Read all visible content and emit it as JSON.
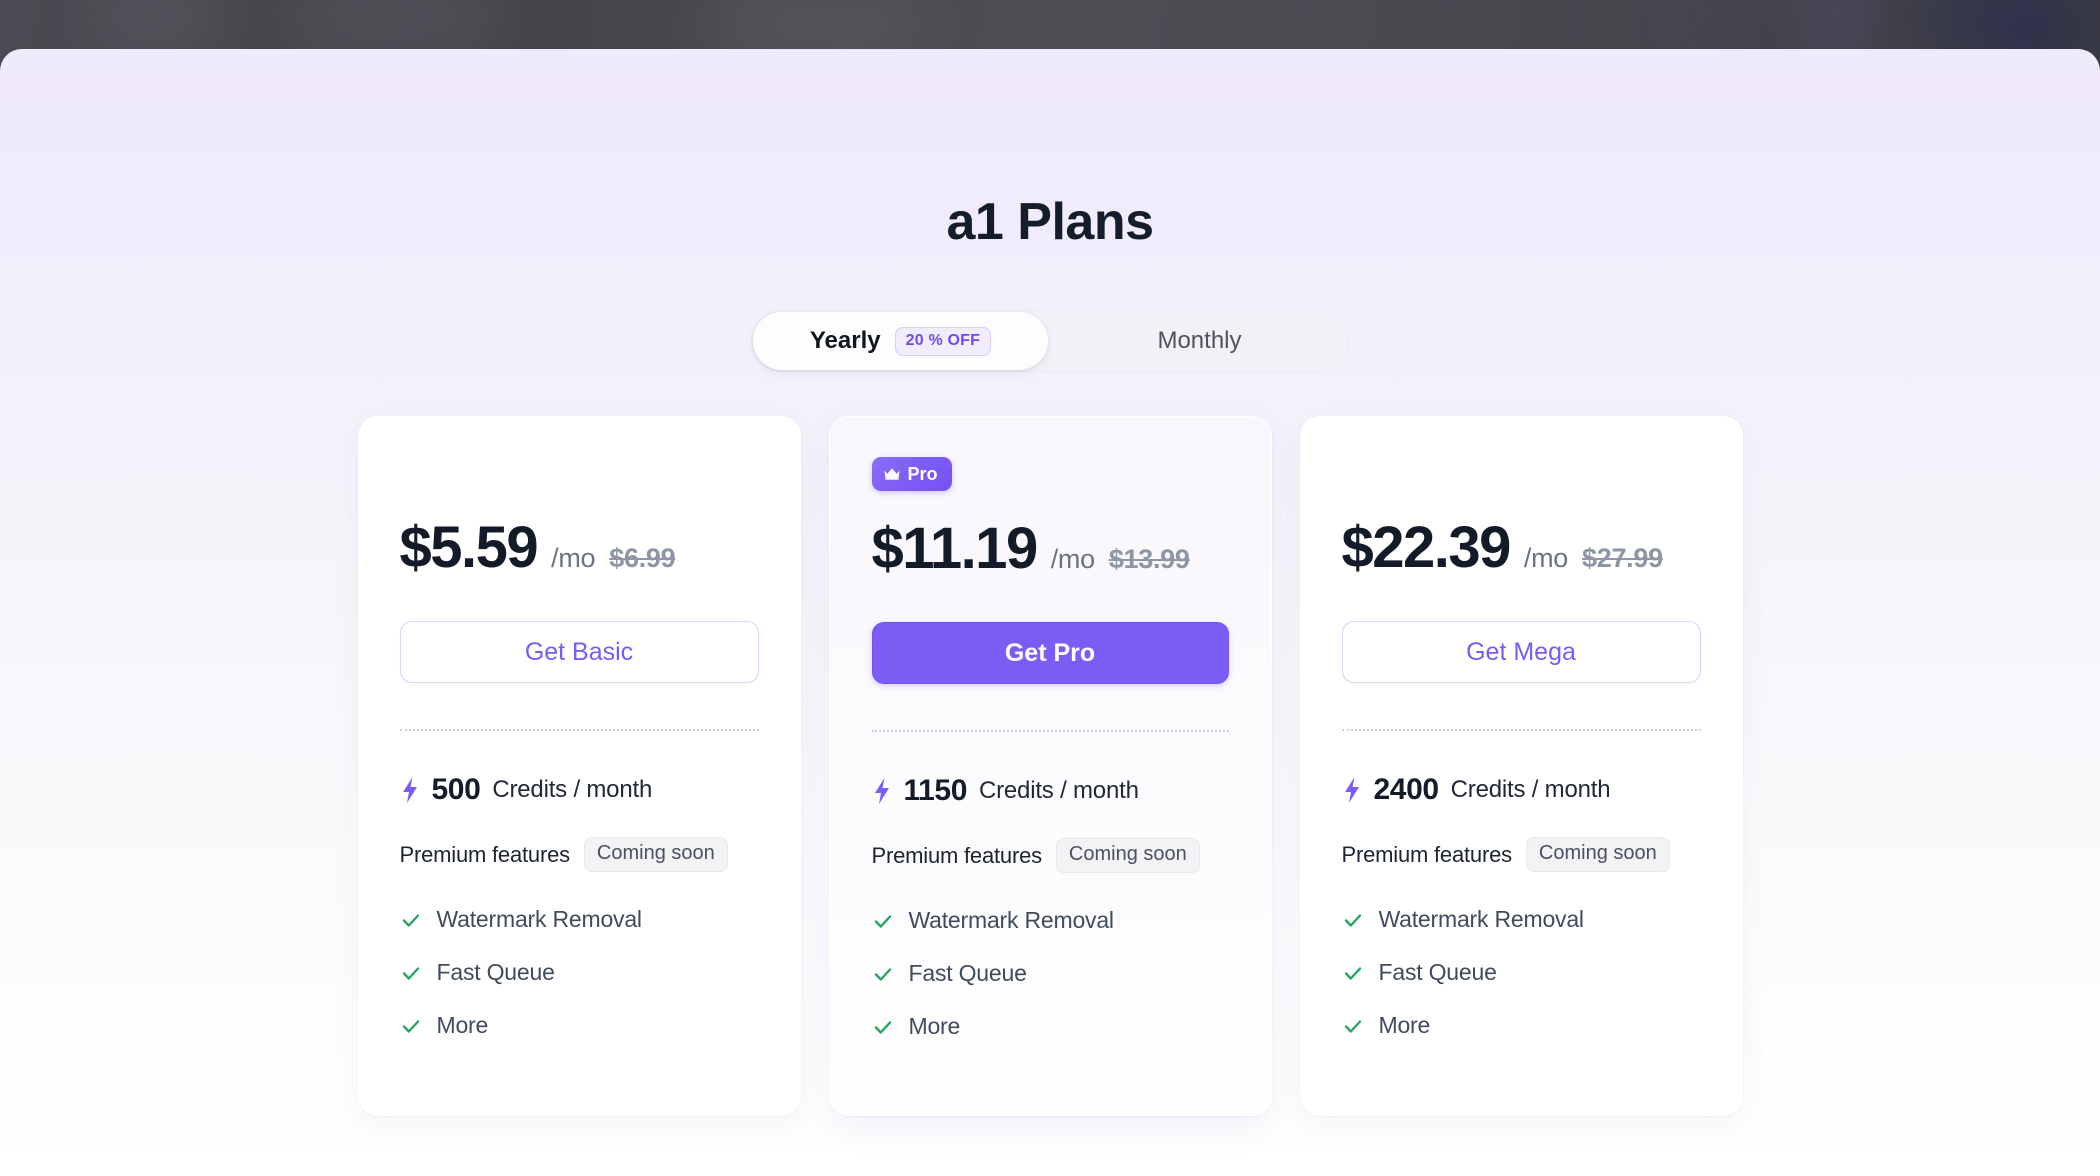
{
  "modal": {
    "title": "a1 Plans"
  },
  "billing_toggle": {
    "options": [
      {
        "label": "Yearly",
        "badge": "20 % OFF",
        "active": true
      },
      {
        "label": "Monthly",
        "badge": "",
        "active": false
      }
    ]
  },
  "colors": {
    "accent_purple": "#7b5cf5",
    "badge_purple_text": "#6d4df0",
    "check_green": "#28a664",
    "title_navy": "#151c2c",
    "old_price_gray": "#8e96a6"
  },
  "plans": [
    {
      "id": "basic",
      "badge": "",
      "badge_icon": "",
      "price": "$5.59",
      "period": "/mo",
      "old_price": "$6.99",
      "cta_label": "Get Basic",
      "cta_style": "outline",
      "credits_icon": "bolt-icon",
      "credits_amount": "500",
      "credits_label": "Credits / month",
      "premium_label": "Premium features",
      "premium_status": "Coming soon",
      "features": [
        "Watermark Removal",
        "Fast Queue",
        "More"
      ]
    },
    {
      "id": "pro",
      "badge": "Pro",
      "badge_icon": "crown-icon",
      "price": "$11.19",
      "period": "/mo",
      "old_price": "$13.99",
      "cta_label": "Get Pro",
      "cta_style": "solid",
      "credits_icon": "bolt-icon",
      "credits_amount": "1150",
      "credits_label": "Credits / month",
      "premium_label": "Premium features",
      "premium_status": "Coming soon",
      "features": [
        "Watermark Removal",
        "Fast Queue",
        "More"
      ]
    },
    {
      "id": "mega",
      "badge": "",
      "badge_icon": "",
      "price": "$22.39",
      "period": "/mo",
      "old_price": "$27.99",
      "cta_label": "Get Mega",
      "cta_style": "outline",
      "credits_icon": "bolt-icon",
      "credits_amount": "2400",
      "credits_label": "Credits / month",
      "premium_label": "Premium features",
      "premium_status": "Coming soon",
      "features": [
        "Watermark Removal",
        "Fast Queue",
        "More"
      ]
    }
  ]
}
